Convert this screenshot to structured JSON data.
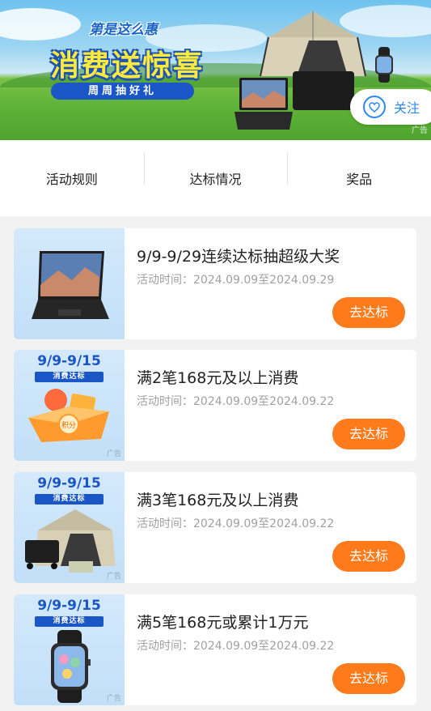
{
  "banner": {
    "brand": "第是这么惠",
    "title": "消费送惊喜",
    "subtitle": "周周抽好礼",
    "follow_label": "关注",
    "ad_label": "广告",
    "follow_icon": "heart-icon"
  },
  "tabs": [
    {
      "label": "活动规则"
    },
    {
      "label": "达标情况"
    },
    {
      "label": "奖品"
    }
  ],
  "cards": [
    {
      "title": "9/9-9/29连续达标抽超级大奖",
      "time": "活动时间：2024.09.09至2024.09.29",
      "button": "去达标",
      "image": "laptop-image"
    },
    {
      "title": "满2笔168元及以上消费",
      "time": "活动时间：2024.09.09至2024.09.22",
      "button": "去达标",
      "period": "9/9-9/15",
      "tag": "消费达标",
      "ad": "广告",
      "image": "points-gift-box-image",
      "image_text": "积分"
    },
    {
      "title": "满3笔168元及以上消费",
      "time": "活动时间：2024.09.09至2024.09.22",
      "button": "去达标",
      "period": "9/9-9/15",
      "tag": "消费达标",
      "ad": "广告",
      "image": "tent-cart-image"
    },
    {
      "title": "满5笔168元或累计1万元",
      "time": "活动时间：2024.09.09至2024.09.22",
      "button": "去达标",
      "period": "9/9-9/15",
      "tag": "消费达标",
      "ad": "广告",
      "image": "smartwatch-image"
    }
  ],
  "colors": {
    "accent_button": "#ff7a1a",
    "brand_blue": "#1a56c6",
    "follow_blue": "#2b8af0"
  }
}
